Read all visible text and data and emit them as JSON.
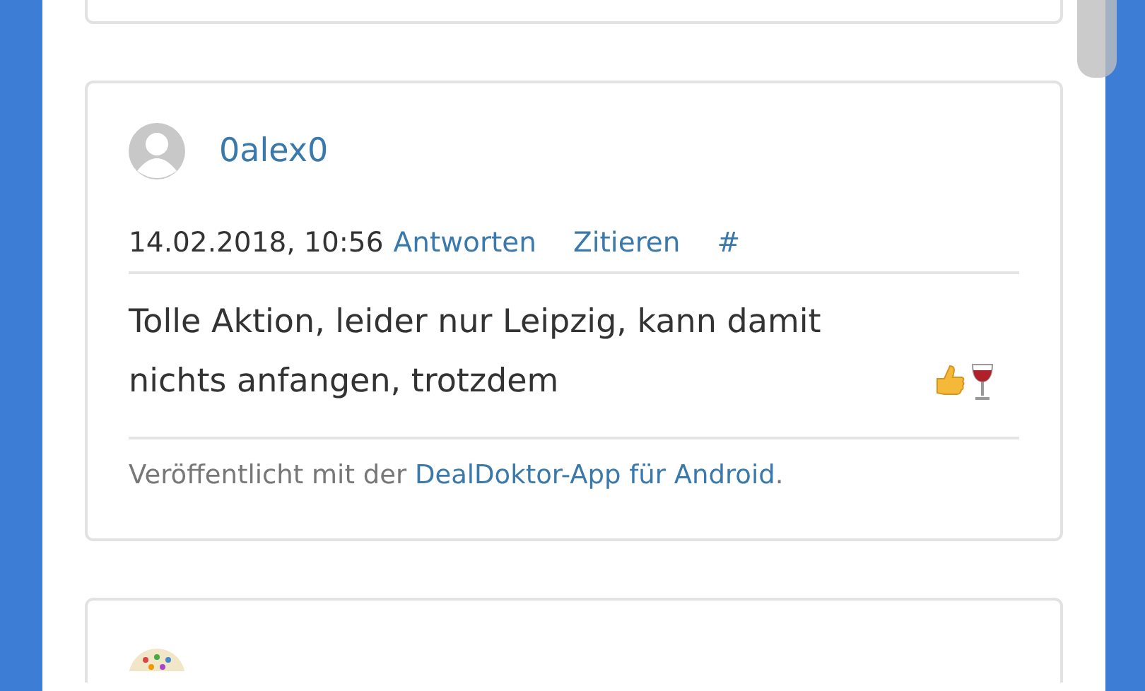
{
  "comment": {
    "author": "0alex0",
    "date": "14.02.2018, 10:56",
    "actions": [
      "Antworten",
      "Zitieren",
      "#"
    ],
    "text": "Tolle Aktion, leider nur Leipzig, kann damit nichts anfangen, trotzdem",
    "footer": {
      "prefix": "Veröffentlicht mit der ",
      "link": "DealDoktor-App für Android",
      "suffix": "."
    }
  }
}
